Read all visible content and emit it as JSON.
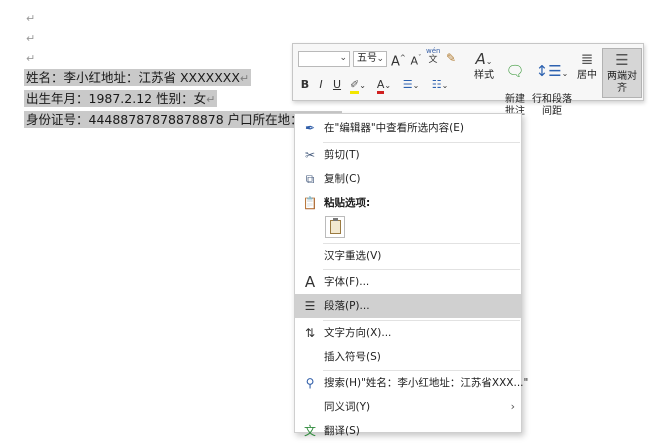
{
  "document": {
    "lines": [
      "姓名：李小红地址：江苏省 XXXXXXX",
      "出生年月：1987.2.12 性别：女",
      "身份证号：44488787878878878 户口所在地：江苏省"
    ],
    "para_mark": "↵"
  },
  "toolbar": {
    "font_size": "五号",
    "grow_font": "A",
    "shrink_font": "A",
    "phonetic": "wén",
    "bold": "B",
    "italic": "I",
    "underline": "U",
    "font_color": "A",
    "styles": "样式",
    "new_comment": "新建\n批注",
    "line_spacing": "行和段落\n间距",
    "center": "居中",
    "justify": "两端对齐"
  },
  "context_menu": {
    "items": [
      {
        "label": "在\"编辑器\"中查看所选内容(E)",
        "icon": "pen-icon"
      },
      {
        "label": "剪切(T)",
        "icon": "scissors-icon"
      },
      {
        "label": "复制(C)",
        "icon": "copy-icon"
      },
      {
        "label": "粘贴选项:",
        "icon": "paste-icon"
      },
      {
        "label": "汉字重选(V)",
        "icon": ""
      },
      {
        "label": "字体(F)...",
        "icon": "font-icon"
      },
      {
        "label": "段落(P)...",
        "icon": "paragraph-icon"
      },
      {
        "label": "文字方向(X)...",
        "icon": "text-direction-icon"
      },
      {
        "label": "插入符号(S)",
        "icon": ""
      },
      {
        "label": "搜索(H)\"姓名：李小红地址：江苏省XXX...\"",
        "icon": "search-icon"
      },
      {
        "label": "同义词(Y)",
        "icon": ""
      },
      {
        "label": "翻译(S)",
        "icon": "translate-icon"
      }
    ]
  }
}
